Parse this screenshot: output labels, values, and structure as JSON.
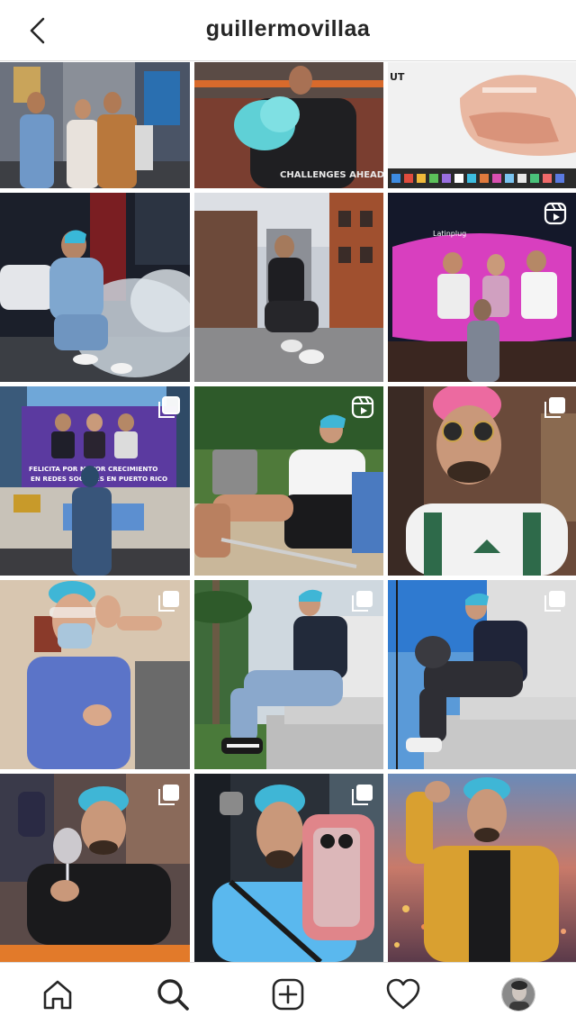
{
  "header": {
    "username": "guillermovillaa",
    "back_icon": "chevron-left-icon"
  },
  "grid": {
    "tiles": [
      {
        "id": 1,
        "badge": "none",
        "tone": "street-group"
      },
      {
        "id": 2,
        "badge": "none",
        "tone": "cotton-candy"
      },
      {
        "id": 3,
        "badge": "none",
        "tone": "sneaker-screenshot"
      },
      {
        "id": 4,
        "badge": "none",
        "tone": "night-smoke"
      },
      {
        "id": 5,
        "badge": "none",
        "tone": "chinatown-street"
      },
      {
        "id": 6,
        "badge": "reel",
        "tone": "times-square-billboard"
      },
      {
        "id": 7,
        "badge": "carousel",
        "tone": "purple-billboard"
      },
      {
        "id": 8,
        "badge": "reel",
        "tone": "beach-chair"
      },
      {
        "id": 9,
        "badge": "carousel",
        "tone": "pink-hair-glasses"
      },
      {
        "id": 10,
        "badge": "carousel",
        "tone": "medical-scrubs"
      },
      {
        "id": 11,
        "badge": "carousel",
        "tone": "palm-stairs"
      },
      {
        "id": 12,
        "badge": "carousel",
        "tone": "rooftop-sitting"
      },
      {
        "id": 13,
        "badge": "carousel",
        "tone": "wine-glass"
      },
      {
        "id": 14,
        "badge": "carousel",
        "tone": "car-selfie"
      },
      {
        "id": 15,
        "badge": "none",
        "tone": "gold-jacket"
      }
    ]
  },
  "billboards": {
    "purple_line1": "FELICITA POR MAYOR CRECIMIENTO",
    "purple_line2": "EN REDES SOCIALES EN PUERTO RICO",
    "shirt_text": "CHALLENGES AHEAD",
    "screen_brand": "Latinplug"
  },
  "bottom_nav": {
    "items": [
      {
        "name": "home",
        "icon": "home-icon"
      },
      {
        "name": "search",
        "icon": "search-icon"
      },
      {
        "name": "create",
        "icon": "add-post-icon"
      },
      {
        "name": "activity",
        "icon": "heart-icon"
      },
      {
        "name": "profile",
        "icon": "avatar"
      }
    ]
  },
  "colors": {
    "text": "#262626",
    "divider": "#dbdbdb",
    "badge": "#ffffff"
  }
}
